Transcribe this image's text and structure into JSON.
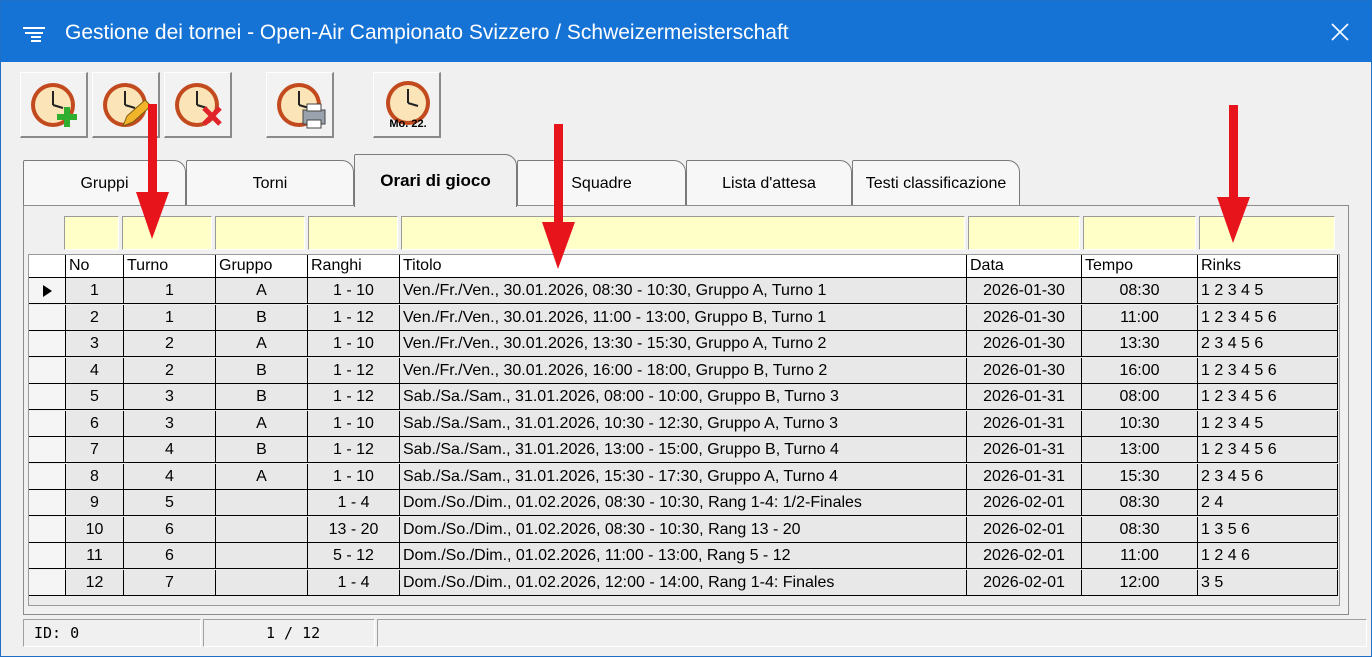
{
  "window": {
    "title": "Gestione dei tornei - Open-Air Campionato Svizzero / Schweizermeisterschaft"
  },
  "toolbar": {
    "buttons": [
      {
        "icon": "clock-add-icon"
      },
      {
        "icon": "clock-edit-icon"
      },
      {
        "icon": "clock-delete-icon"
      },
      {
        "icon": "clock-print-icon"
      },
      {
        "icon": "clock-date-icon",
        "label": "Mo. 22."
      }
    ]
  },
  "tabs": [
    {
      "label": "Gruppi"
    },
    {
      "label": "Torni"
    },
    {
      "label": "Orari di gioco",
      "active": true
    },
    {
      "label": "Squadre"
    },
    {
      "label": "Lista d'attesa"
    },
    {
      "label": "Testi classificazione"
    }
  ],
  "grid": {
    "columns": [
      "No",
      "Turno",
      "Gruppo",
      "Ranghi",
      "Titolo",
      "Data",
      "Tempo",
      "Rinks"
    ],
    "rows": [
      [
        "1",
        "1",
        "A",
        "1 - 10",
        "Ven./Fr./Ven., 30.01.2026, 08:30 - 10:30, Gruppo A, Turno 1",
        "2026-01-30",
        "08:30",
        "1 2 3 4 5"
      ],
      [
        "2",
        "1",
        "B",
        "1 - 12",
        "Ven./Fr./Ven., 30.01.2026, 11:00 - 13:00, Gruppo B, Turno 1",
        "2026-01-30",
        "11:00",
        "1 2 3 4 5 6"
      ],
      [
        "3",
        "2",
        "A",
        "1 - 10",
        "Ven./Fr./Ven., 30.01.2026, 13:30 - 15:30, Gruppo A, Turno 2",
        "2026-01-30",
        "13:30",
        "2 3 4 5 6"
      ],
      [
        "4",
        "2",
        "B",
        "1 - 12",
        "Ven./Fr./Ven., 30.01.2026, 16:00 - 18:00, Gruppo B, Turno 2",
        "2026-01-30",
        "16:00",
        "1 2 3 4 5 6"
      ],
      [
        "5",
        "3",
        "B",
        "1 - 12",
        "Sab./Sa./Sam., 31.01.2026, 08:00 - 10:00, Gruppo B, Turno 3",
        "2026-01-31",
        "08:00",
        "1 2 3 4 5 6"
      ],
      [
        "6",
        "3",
        "A",
        "1 - 10",
        "Sab./Sa./Sam., 31.01.2026, 10:30 - 12:30, Gruppo A, Turno 3",
        "2026-01-31",
        "10:30",
        "1 2 3 4 5"
      ],
      [
        "7",
        "4",
        "B",
        "1 - 12",
        "Sab./Sa./Sam., 31.01.2026, 13:00 - 15:00, Gruppo B, Turno 4",
        "2026-01-31",
        "13:00",
        "1 2 3 4 5 6"
      ],
      [
        "8",
        "4",
        "A",
        "1 - 10",
        "Sab./Sa./Sam., 31.01.2026, 15:30 - 17:30, Gruppo A, Turno 4",
        "2026-01-31",
        "15:30",
        "2 3 4 5 6"
      ],
      [
        "9",
        "5",
        "",
        "1 - 4",
        "Dom./So./Dim., 01.02.2026, 08:30 - 10:30, Rang 1-4: 1/2-Finales",
        "2026-02-01",
        "08:30",
        "2 4"
      ],
      [
        "10",
        "6",
        "",
        "13 - 20",
        "Dom./So./Dim., 01.02.2026, 08:30 - 10:30, Rang 13 - 20",
        "2026-02-01",
        "08:30",
        "1 3 5 6"
      ],
      [
        "11",
        "6",
        "",
        "5 - 12",
        "Dom./So./Dim., 01.02.2026, 11:00 - 13:00, Rang 5 - 12",
        "2026-02-01",
        "11:00",
        "1 2 4 6"
      ],
      [
        "12",
        "7",
        "",
        "1 - 4",
        "Dom./So./Dim., 01.02.2026, 12:00 - 14:00, Rang 1-4: Finales",
        "2026-02-01",
        "12:00",
        "3 5"
      ]
    ],
    "selected_row": 0
  },
  "status": {
    "id": "ID: 0",
    "position": "1 / 12",
    "extra": ""
  },
  "colors": {
    "titlebar": "#1673d6",
    "filter": "#ffffc8",
    "arrow": "#e8141b"
  }
}
